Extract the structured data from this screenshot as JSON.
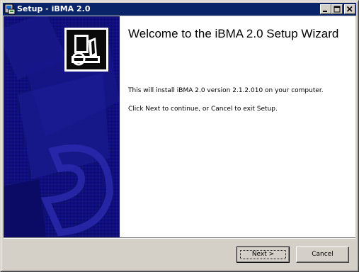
{
  "window": {
    "title": "Setup - iBMA 2.0",
    "controls": {
      "minimize": "minimize-icon",
      "maximize": "maximize-icon",
      "close": "close-icon"
    }
  },
  "welcome": {
    "heading": "Welcome to the iBMA 2.0 Setup Wizard",
    "install_text": "This will install iBMA 2.0 version 2.1.2.010 on your computer.",
    "continue_text": "Click Next to continue, or Cancel to exit Setup."
  },
  "buttons": {
    "next": "Next >",
    "cancel": "Cancel"
  },
  "colors": {
    "titlebar": "#0a246a",
    "banner": "#0e0e73",
    "dialog": "#d4d0c8"
  }
}
